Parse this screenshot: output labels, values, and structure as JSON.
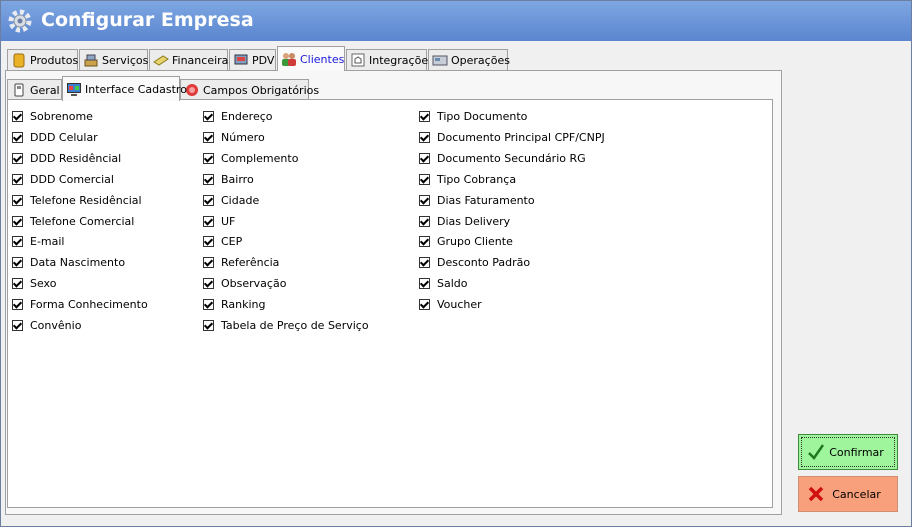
{
  "window": {
    "title": "Configurar Empresa"
  },
  "top_tabs": [
    {
      "label": "Produtos",
      "icon": "box-icon"
    },
    {
      "label": "Serviços",
      "icon": "tools-icon"
    },
    {
      "label": "Financeiras",
      "icon": "money-icon"
    },
    {
      "label": "PDV",
      "icon": "pos-icon"
    },
    {
      "label": "Clientes",
      "icon": "users-icon",
      "active": true
    },
    {
      "label": "Integrações",
      "icon": "integration-icon"
    },
    {
      "label": "Operações",
      "icon": "operations-icon"
    }
  ],
  "inner_tabs": [
    {
      "label": "Geral",
      "icon": "general-icon"
    },
    {
      "label": "Interface Cadastro",
      "icon": "monitor-icon",
      "active": true
    },
    {
      "label": "Campos Obrigatórios",
      "icon": "required-icon"
    }
  ],
  "columns": [
    [
      "Sobrenome",
      "DDD Celular",
      "DDD Residêncial",
      "DDD Comercial",
      "Telefone Residêncial",
      "Telefone Comercial",
      "E-mail",
      "Data Nascimento",
      "Sexo",
      "Forma Conhecimento",
      "Convênio"
    ],
    [
      "Endereço",
      "Número",
      "Complemento",
      "Bairro",
      "Cidade",
      "UF",
      "CEP",
      "Referência",
      "Observação",
      "Ranking",
      "Tabela de Preço de Serviço"
    ],
    [
      "Tipo Documento",
      "Documento Principal CPF/CNPJ",
      "Documento Secundário RG",
      "Tipo Cobrança",
      "Dias Faturamento",
      "Dias Delivery",
      "Grupo Cliente",
      "Desconto Padrão",
      "Saldo",
      "Voucher"
    ]
  ],
  "buttons": {
    "confirm": "Confirmar",
    "cancel": "Cancelar"
  },
  "colors": {
    "titlebar": "#6a96d8",
    "confirm_bg": "#9ff59b",
    "cancel_bg": "#f8a07c",
    "active_tab_text": "#1a1adb"
  }
}
